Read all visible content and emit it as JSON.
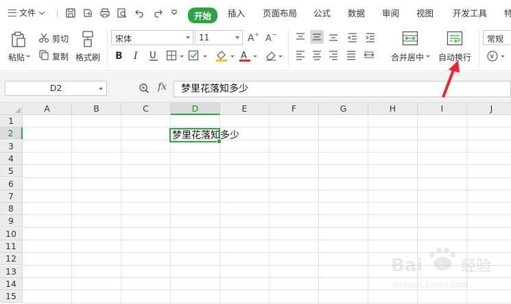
{
  "menubar": {
    "file_label": "文件",
    "tabs": [
      {
        "label": "开始",
        "active": true
      },
      {
        "label": "插入"
      },
      {
        "label": "页面布局"
      },
      {
        "label": "公式"
      },
      {
        "label": "数据"
      },
      {
        "label": "审阅"
      },
      {
        "label": "视图"
      },
      {
        "label": "开发工具"
      },
      {
        "label": "特"
      }
    ]
  },
  "ribbon": {
    "paste": "粘贴",
    "cut": "剪切",
    "copy": "复制",
    "format_painter": "格式刷",
    "font_name": "宋体",
    "font_size": "11",
    "merge_center": "合并居中",
    "wrap_text": "自动换行",
    "number_format": "常规"
  },
  "formula_bar": {
    "cell_ref": "D2",
    "fx": "fx",
    "content": "梦里花落知多少"
  },
  "sheet": {
    "columns": [
      "A",
      "B",
      "C",
      "D",
      "E",
      "F",
      "G",
      "H",
      "I",
      "J"
    ],
    "rows": [
      "1",
      "2",
      "3",
      "4",
      "5",
      "6",
      "7",
      "8",
      "9",
      "10",
      "11",
      "12",
      "13",
      "14",
      "15"
    ],
    "selected_cell": "D2",
    "selected_column": "D",
    "selected_row": "2",
    "cell_D2": "梦里花落知多少"
  },
  "colors": {
    "accent": "#2da344",
    "arrow": "#e8262e"
  },
  "icons": [
    "hamburger-icon",
    "save-icon",
    "undo-icon",
    "redo-icon",
    "print-icon",
    "preview-icon",
    "magnifier-icon",
    "cut-icon",
    "copy-icon",
    "format-painter-icon",
    "bold-icon",
    "italic-icon",
    "underline-icon",
    "border-icon",
    "fill-color-icon",
    "font-color-icon",
    "clear-icon",
    "align-icon",
    "merge-icon",
    "wrap-icon"
  ]
}
